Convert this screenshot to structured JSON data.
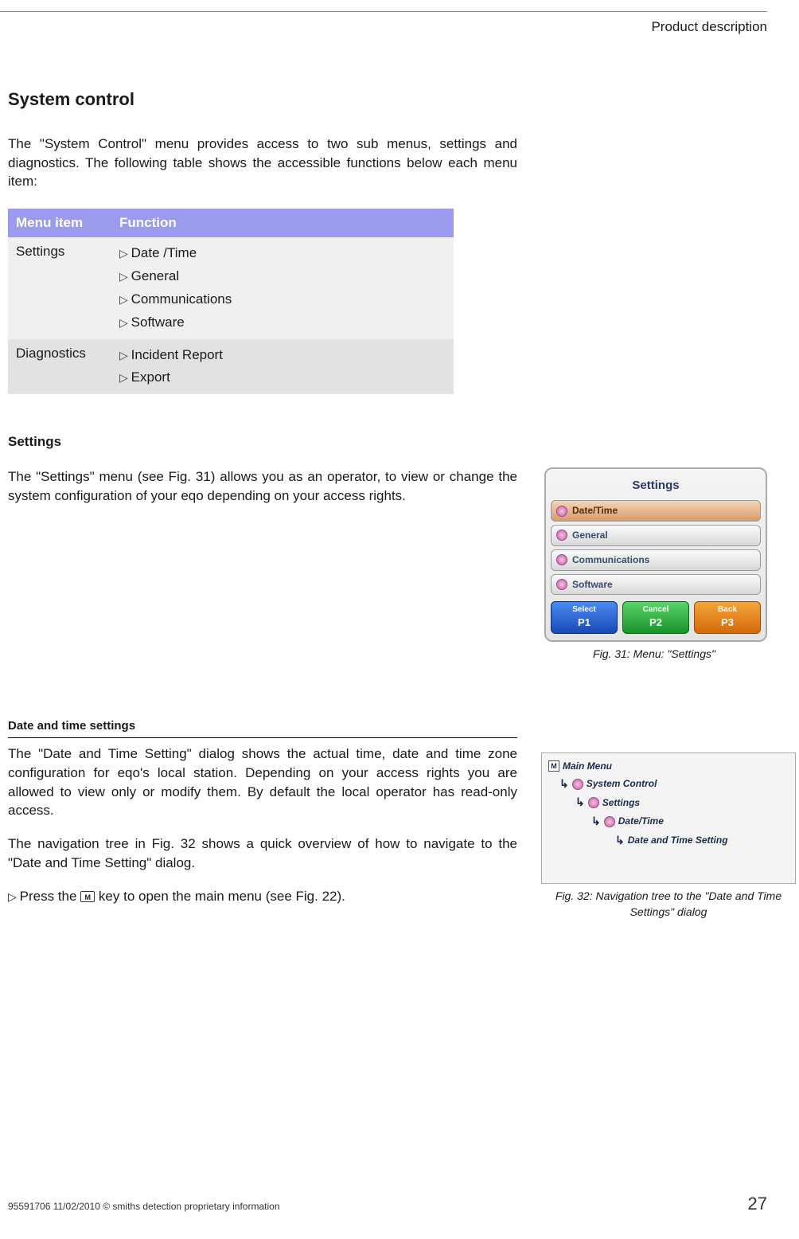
{
  "header": {
    "section": "Product description"
  },
  "h1": "System control",
  "intro": "The \"System Control\" menu provides access to two sub menus, settings and diagnostics. The following table shows the accessible functions below each menu item:",
  "table": {
    "headers": {
      "c1": "Menu item",
      "c2": "Function"
    },
    "rows": [
      {
        "menu": "Settings",
        "fns": [
          "Date /Time",
          "General",
          "Communications",
          "Software"
        ]
      },
      {
        "menu": "Diagnostics",
        "fns": [
          "Incident Report",
          "Export"
        ]
      }
    ]
  },
  "settings_h": "Settings",
  "settings_p": "The \"Settings\" menu (see Fig. 31) allows you as an operator, to view or change the system configuration of your eqo depending on your access rights.",
  "fig31": {
    "title": "Settings",
    "items": [
      "Date/Time",
      "General",
      "Communications",
      "Software"
    ],
    "btns": [
      {
        "t": "Select",
        "b": "P1"
      },
      {
        "t": "Cancel",
        "b": "P2"
      },
      {
        "t": "Back",
        "b": "P3"
      }
    ],
    "caption": "Fig. 31: Menu: \"Settings\""
  },
  "dt_h": "Date and time settings",
  "dt_p1": "The \"Date and Time Setting\" dialog shows the actual time, date and time zone configuration for eqo's local station. Depending on your access rights you are allowed to view only or modify them. By default the local operator has  read-only access.",
  "dt_p2": "The navigation tree in Fig. 32 shows a quick overview of how to navigate to the \"Date and Time Setting\" dialog.",
  "dt_step_a": "Press the ",
  "dt_step_key": "M",
  "dt_step_b": " key to open the main menu (see Fig. 22).",
  "fig32": {
    "rows": [
      {
        "indent": 0,
        "icon": "menu-square-icon",
        "label": "Main Menu"
      },
      {
        "indent": 1,
        "icon": "dot-icon",
        "label": "System Control"
      },
      {
        "indent": 2,
        "icon": "dot-icon",
        "label": "Settings"
      },
      {
        "indent": 3,
        "icon": "dot-icon",
        "label": "Date/Time"
      },
      {
        "indent": 4,
        "icon": "",
        "label": "Date and Time Setting"
      }
    ],
    "caption": "Fig. 32: Navigation tree to the \"Date and Time Settings\" dialog"
  },
  "footer": {
    "left": "95591706 11/02/2010 © smiths detection proprietary information",
    "page": "27"
  }
}
